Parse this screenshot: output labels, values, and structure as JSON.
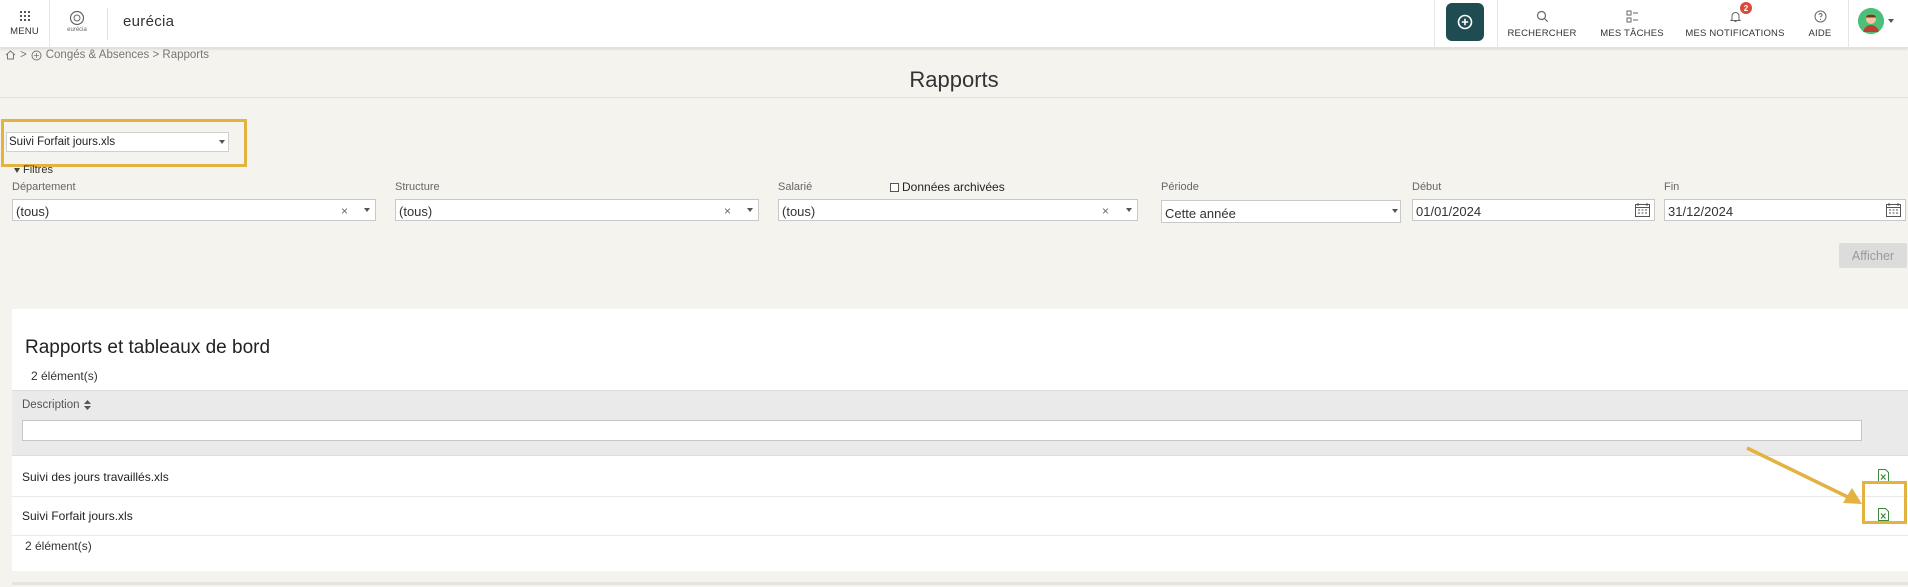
{
  "header": {
    "menu_label": "MENU",
    "logo_small_text": "eurécia",
    "brand": "eurécia",
    "items": [
      {
        "label": "RECHERCHER",
        "icon": "search-icon"
      },
      {
        "label": "MES TÂCHES",
        "icon": "tasks-icon"
      },
      {
        "label": "MES NOTIFICATIONS",
        "icon": "bell-icon",
        "badge": "2"
      },
      {
        "label": "AIDE",
        "icon": "help-icon"
      }
    ],
    "colors": {
      "add_button": "#1f4b52",
      "badge": "#d94a38",
      "highlight": "#e3b241"
    }
  },
  "breadcrumb": {
    "sep": ">",
    "trail": "Congés & Absences > Rapports"
  },
  "page": {
    "title": "Rapports"
  },
  "report_select": {
    "value": "Suivi Forfait jours.xls"
  },
  "filters": {
    "toggle_label": "Filtres",
    "department": {
      "label": "Département",
      "value": "(tous)",
      "clear": "×"
    },
    "structure": {
      "label": "Structure",
      "value": "(tous)",
      "clear": "×"
    },
    "employee": {
      "label": "Salarié",
      "value": "(tous)",
      "clear": "×"
    },
    "archived_label": "Données archivées",
    "period": {
      "label": "Période",
      "value": "Cette année"
    },
    "start": {
      "label": "Début",
      "value": "01/01/2024"
    },
    "end": {
      "label": "Fin",
      "value": "31/12/2024"
    },
    "submit_label": "Afficher"
  },
  "reports": {
    "title": "Rapports et tableaux de bord",
    "count_top": "2 élément(s)",
    "column_description": "Description",
    "rows": [
      {
        "label": "Suivi des jours travaillés.xls",
        "icon": "excel-file-icon"
      },
      {
        "label": "Suivi Forfait jours.xls",
        "icon": "excel-file-icon"
      }
    ],
    "count_bottom": "2 élément(s)"
  }
}
